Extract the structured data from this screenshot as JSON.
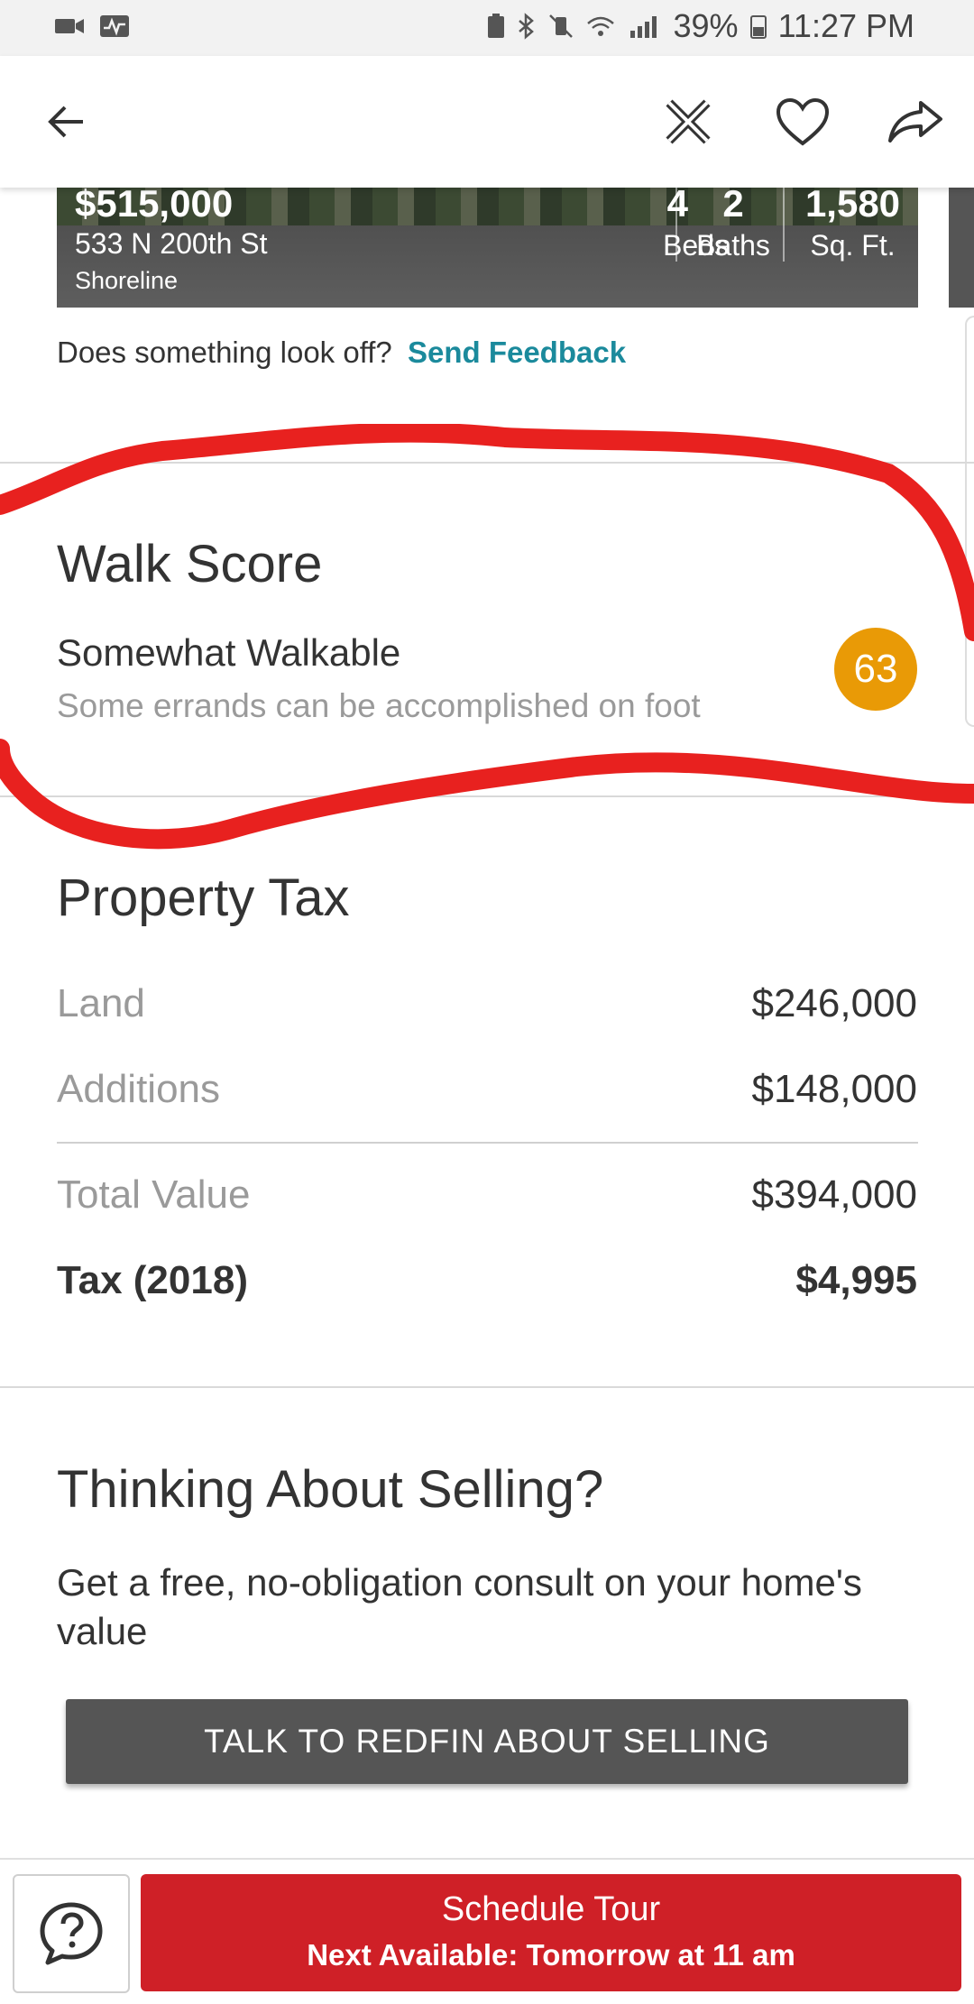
{
  "status_bar": {
    "battery": "39%",
    "time": "11:27 PM"
  },
  "listing": {
    "price": "$515,000",
    "address": "533 N 200th St",
    "city": "Shoreline",
    "beds": "4",
    "beds_label": "Beds",
    "baths": "2",
    "baths_label": "Baths",
    "sqft": "1,580",
    "sqft_label": "Sq. Ft."
  },
  "feedback": {
    "question": "Does something look off?",
    "link": "Send Feedback"
  },
  "walk_score": {
    "title": "Walk Score",
    "rating": "Somewhat Walkable",
    "description": "Some errands can be accomplished on foot",
    "score": "63",
    "badge_color": "#e99a06"
  },
  "property_tax": {
    "title": "Property Tax",
    "rows": [
      {
        "label": "Land",
        "value": "$246,000"
      },
      {
        "label": "Additions",
        "value": "$148,000"
      },
      {
        "label": "Total Value",
        "value": "$394,000"
      },
      {
        "label": "Tax (2018)",
        "value": "$4,995"
      }
    ]
  },
  "selling": {
    "title": "Thinking About Selling?",
    "description": "Get a free, no-obligation consult on your home's value",
    "button": "TALK TO REDFIN ABOUT SELLING"
  },
  "bottom_bar": {
    "tour_title": "Schedule Tour",
    "tour_subtitle": "Next Available: Tomorrow at 11 am",
    "tour_color": "#cf2027"
  },
  "icons": [
    "back-arrow-icon",
    "not-interested-icon",
    "heart-icon",
    "share-icon",
    "help-chat-icon"
  ]
}
